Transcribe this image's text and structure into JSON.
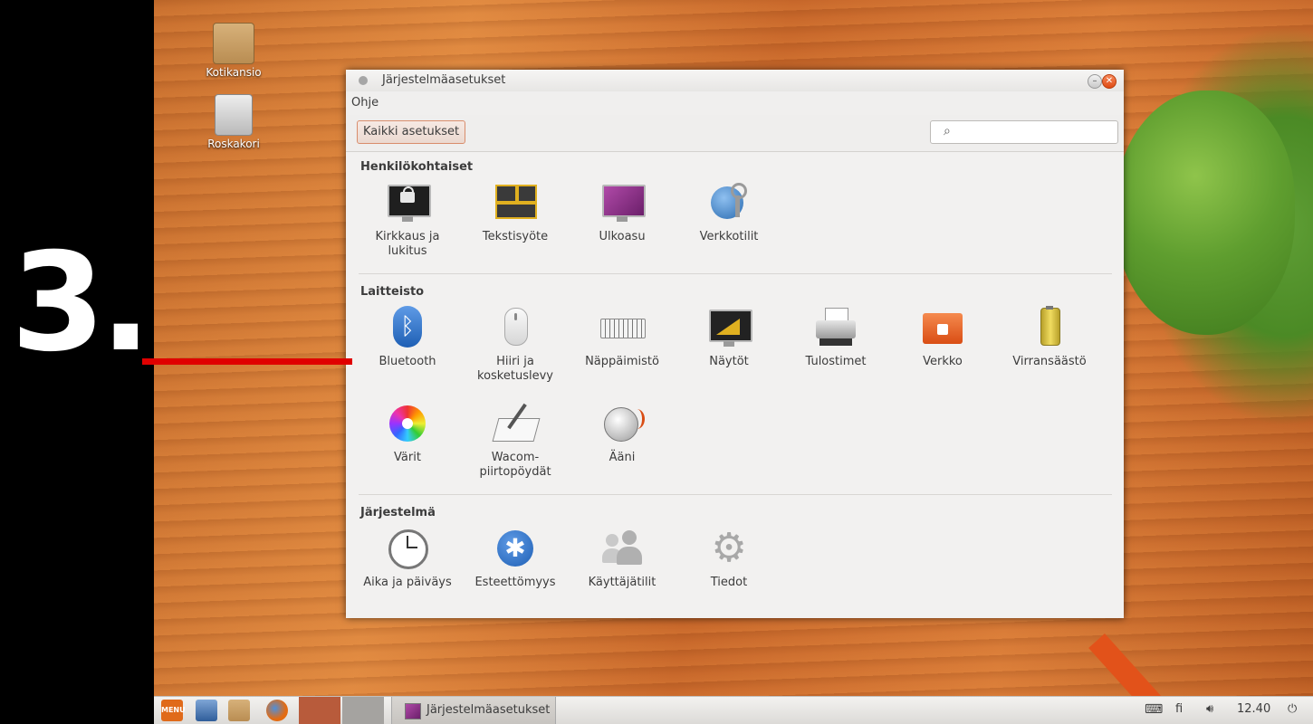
{
  "overlay": {
    "step_number": "3.",
    "line_color": "#e00000"
  },
  "desktop": {
    "icons": [
      {
        "label": "Kotikansio",
        "icon": "home-folder-icon"
      },
      {
        "label": "Roskakori",
        "icon": "trash-icon"
      }
    ]
  },
  "window": {
    "title": "Järjestelmäasetukset",
    "menu": {
      "help": "Ohje"
    },
    "toolbar": {
      "all_settings": "Kaikki asetukset",
      "search_placeholder": ""
    },
    "sections": [
      {
        "title": "Henkilökohtaiset",
        "items": [
          {
            "label": "Kirkkaus ja lukitus",
            "icon": "brightness-lock-icon"
          },
          {
            "label": "Tekstisyöte",
            "icon": "text-entry-icon"
          },
          {
            "label": "Ulkoasu",
            "icon": "appearance-icon"
          },
          {
            "label": "Verkkotilit",
            "icon": "online-accounts-icon"
          }
        ]
      },
      {
        "title": "Laitteisto",
        "items": [
          {
            "label": "Bluetooth",
            "icon": "bluetooth-icon"
          },
          {
            "label": "Hiiri ja kosketuslevy",
            "icon": "mouse-icon"
          },
          {
            "label": "Näppäimistö",
            "icon": "keyboard-icon"
          },
          {
            "label": "Näytöt",
            "icon": "displays-icon"
          },
          {
            "label": "Tulostimet",
            "icon": "printer-icon"
          },
          {
            "label": "Verkko",
            "icon": "network-icon"
          },
          {
            "label": "Virransäästö",
            "icon": "power-icon"
          },
          {
            "label": "Värit",
            "icon": "color-icon"
          },
          {
            "label": "Wacom-piirtopöydät",
            "icon": "wacom-icon"
          },
          {
            "label": "Ääni",
            "icon": "sound-icon"
          }
        ]
      },
      {
        "title": "Järjestelmä",
        "items": [
          {
            "label": "Aika ja päiväys",
            "icon": "clock-icon"
          },
          {
            "label": "Esteettömyys",
            "icon": "accessibility-icon"
          },
          {
            "label": "Käyttäjätilit",
            "icon": "users-icon"
          },
          {
            "label": "Tiedot",
            "icon": "gear-icon"
          }
        ]
      }
    ]
  },
  "taskbar": {
    "menu_label": "MENU",
    "window_button": "Järjestelmäasetukset",
    "keyboard_layout": "fi",
    "clock": "12.40"
  }
}
